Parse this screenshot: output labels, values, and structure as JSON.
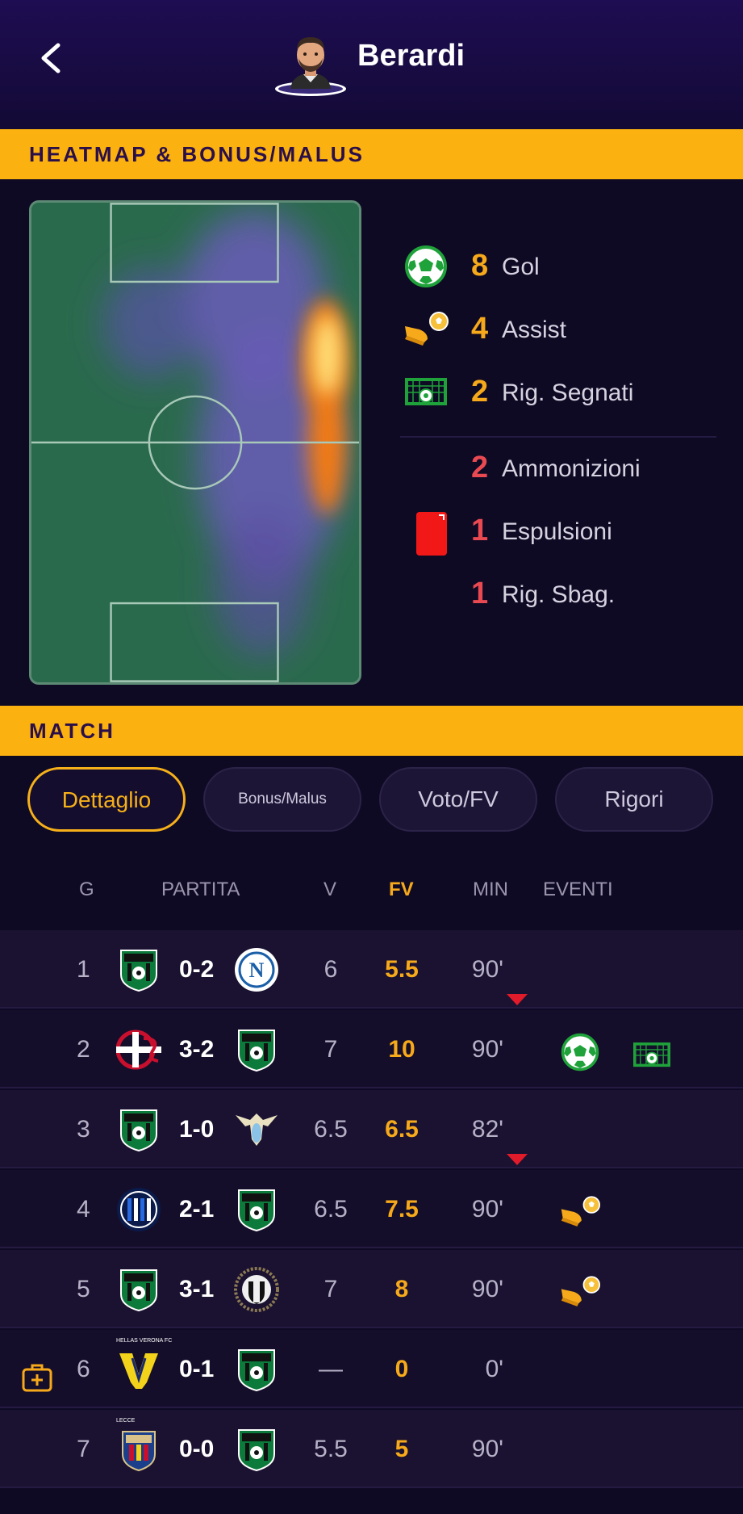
{
  "header": {
    "back_icon": "chevron-left-icon",
    "player_name": "Berardi"
  },
  "sections": {
    "heatmap_title": "HEATMAP & BONUS/MALUS",
    "match_title": "MATCH"
  },
  "bonus": [
    {
      "icon": "soccer-ball-icon",
      "value": "8",
      "label": "Gol",
      "color": "#f6a91a"
    },
    {
      "icon": "assist-boot-icon",
      "value": "4",
      "label": "Assist",
      "color": "#f6a91a"
    },
    {
      "icon": "penalty-goal-icon",
      "value": "2",
      "label": "Rig. Segnati",
      "color": "#f6a91a"
    }
  ],
  "malus": [
    {
      "icon": "",
      "value": "2",
      "label": "Ammonizioni",
      "color": "#e94a52"
    },
    {
      "icon": "red-card-icon",
      "value": "1",
      "label": "Espulsioni",
      "color": "#e94a52"
    },
    {
      "icon": "",
      "value": "1",
      "label": "Rig. Sbag.",
      "color": "#e94a52"
    }
  ],
  "tabs": [
    {
      "label": "Dettaglio",
      "active": true
    },
    {
      "label": "Bonus/Malus",
      "active": false
    },
    {
      "label": "Voto/FV",
      "active": false
    },
    {
      "label": "Rigori",
      "active": false
    }
  ],
  "columns": {
    "g": "G",
    "partita": "PARTITA",
    "v": "V",
    "fv": "FV",
    "min": "MIN",
    "eventi": "EVENTI"
  },
  "matches": [
    {
      "g": "1",
      "home": "Sassuolo",
      "score": "0-2",
      "away": "Napoli",
      "v": "6",
      "fv": "5.5",
      "min": "90'",
      "subbed_off": true,
      "events": []
    },
    {
      "g": "2",
      "home": "Cremonese",
      "score": "3-2",
      "away": "Sassuolo",
      "v": "7",
      "fv": "10",
      "min": "90'",
      "subbed_off": false,
      "events": [
        "soccer-ball-icon",
        "penalty-goal-icon"
      ]
    },
    {
      "g": "3",
      "home": "Sassuolo",
      "score": "1-0",
      "away": "Lazio",
      "v": "6.5",
      "fv": "6.5",
      "min": "82'",
      "subbed_off": true,
      "events": []
    },
    {
      "g": "4",
      "home": "Inter",
      "score": "2-1",
      "away": "Sassuolo",
      "v": "6.5",
      "fv": "7.5",
      "min": "90'",
      "subbed_off": false,
      "events": [
        "assist-boot-icon"
      ]
    },
    {
      "g": "5",
      "home": "Sassuolo",
      "score": "3-1",
      "away": "Udinese",
      "v": "7",
      "fv": "8",
      "min": "90'",
      "subbed_off": false,
      "events": [
        "assist-boot-icon"
      ]
    },
    {
      "g": "6",
      "home": "Hellas Verona",
      "home_caption": "HELLAS VERONA FC",
      "score": "0-1",
      "away": "Sassuolo",
      "v": "—",
      "fv": "0",
      "min": "0'",
      "subbed_off": false,
      "events": [],
      "extra_icon": "medical-kit-icon"
    },
    {
      "g": "7",
      "home": "Lecce",
      "home_caption": "LECCE",
      "score": "0-0",
      "away": "Sassuolo",
      "v": "5.5",
      "fv": "5",
      "min": "90'",
      "subbed_off": false,
      "events": []
    }
  ],
  "heatmap_level": {
    "hot_zone": "right flank, attacking half"
  }
}
